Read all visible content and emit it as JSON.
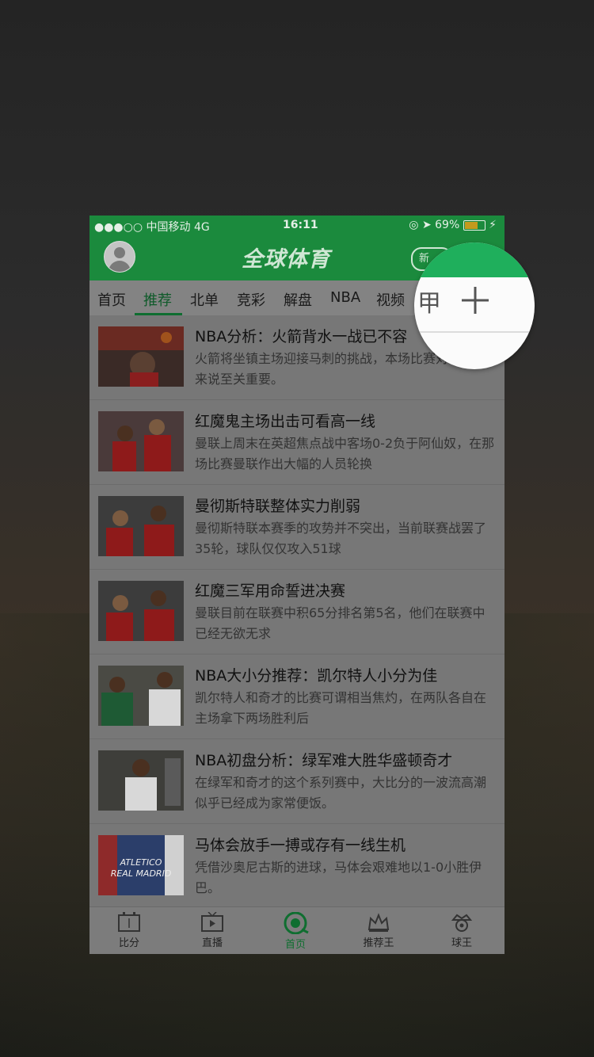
{
  "status_bar": {
    "carrier": "●●●○○ 中国移动  4G",
    "time": "16:11",
    "battery_text": "◎ ➤ 69%",
    "battery_level_percent": 69
  },
  "header": {
    "logo": "全球体育",
    "right_button_label": "新"
  },
  "tabs": [
    "首页",
    "推荐",
    "北单",
    "竞彩",
    "解盘",
    "NBA",
    "视频"
  ],
  "active_tab_index": 1,
  "magnifier": {
    "partial_tab_text": "甲",
    "add_symbol": "+"
  },
  "articles": [
    {
      "title": "NBA分析：火箭背水一战已不容",
      "desc": "火箭将坐镇主场迎接马刺的挑战，本场比赛对于火箭来说至关重要。"
    },
    {
      "title": "红魔鬼主场出击可看高一线",
      "desc": "曼联上周末在英超焦点战中客场0-2负于阿仙奴，在那场比赛曼联作出大幅的人员轮换"
    },
    {
      "title": "曼彻斯特联整体实力削弱",
      "desc": "曼彻斯特联本赛季的攻势并不突出，当前联赛战罢了35轮，球队仅仅攻入51球"
    },
    {
      "title": "红魔三军用命誓进决赛",
      "desc": "曼联目前在联赛中积65分排名第5名，他们在联赛中已经无欲无求"
    },
    {
      "title": "NBA大小分推荐：凯尔特人小分为佳",
      "desc": "凯尔特人和奇才的比赛可谓相当焦灼，在两队各自在主场拿下两场胜利后"
    },
    {
      "title": "NBA初盘分析：绿军难大胜华盛顿奇才",
      "desc": "在绿军和奇才的这个系列赛中，大比分的一波流高潮似乎已经成为家常便饭。"
    },
    {
      "title": "马体会放手一搏或存有一线生机",
      "desc": "凭借沙奥尼古斯的进球，马体会艰难地以1-0小胜伊巴。"
    }
  ],
  "thumb_text": {
    "line1": "ATLETICO",
    "line2": "REAL MADRID"
  },
  "bottom_nav": [
    {
      "label": "比分",
      "icon": "scoreboard-icon"
    },
    {
      "label": "直播",
      "icon": "tv-icon"
    },
    {
      "label": "首页",
      "icon": "ball-home-icon"
    },
    {
      "label": "推荐王",
      "icon": "crown-icon"
    },
    {
      "label": "球王",
      "icon": "king-crown-icon"
    }
  ],
  "colors": {
    "brand_green": "#1b8a3d",
    "active_green": "#0f6e30"
  }
}
